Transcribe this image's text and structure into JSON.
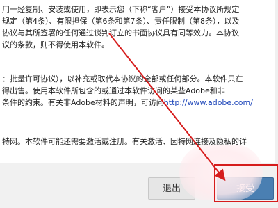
{
  "document": {
    "paragraph1": [
      "用一经复制、安装或使用，即表示您（下称“客户”）接受本协议所规定",
      "规定（第4条）、有限担保（第6条和第7条）、责任限制（第8条），以及",
      "协议与其所签署的任何通过谈判订立的书面协议具有同等效力。本协议",
      "议的条款，则不得使用本软件。"
    ],
    "paragraph2": [
      "：批量许可协议），以补充或取代本协议的全部或任何部分。本软件只在",
      "得出售。使用本软件所包含的或通过本软件访问的某些Adobe和非",
      "条件的约束。有关非Adobe材料的声明，可访问"
    ],
    "link_text": "http://www.adobe.com/",
    "paragraph3": "特网。本软件可能还需要激活或注册。有关激活、因特网连接及隐私的详"
  },
  "buttons": {
    "quit_label": "退出",
    "accept_label": "接受"
  },
  "colors": {
    "annotation_red": "#d61c1c",
    "accept_button": "#4a7fb2",
    "link": "#1a43b8"
  }
}
